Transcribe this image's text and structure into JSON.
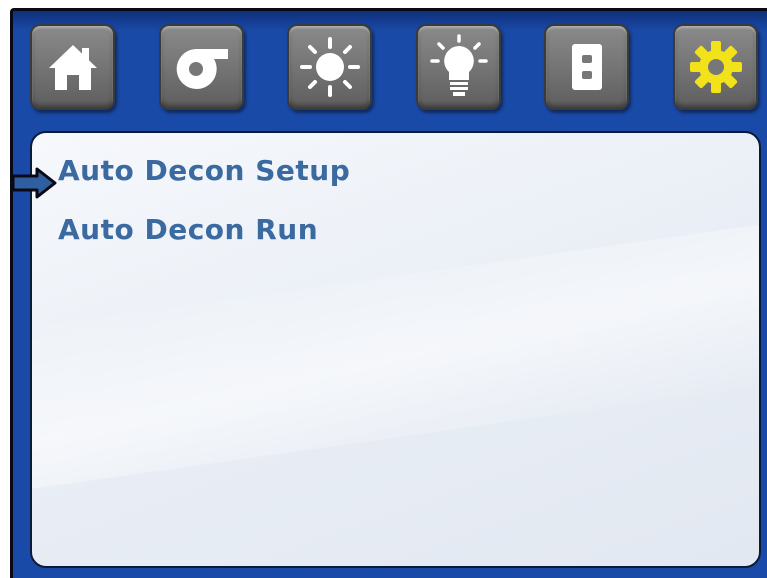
{
  "toolbar": {
    "buttons": [
      {
        "name": "home",
        "icon": "home-icon"
      },
      {
        "name": "fan",
        "icon": "blower-fan-icon"
      },
      {
        "name": "uv-lamp",
        "icon": "sun-icon"
      },
      {
        "name": "light",
        "icon": "light-bulb-icon"
      },
      {
        "name": "outlet",
        "icon": "outlet-icon"
      },
      {
        "name": "settings",
        "icon": "gear-icon",
        "active_color": "#f2e21a"
      }
    ]
  },
  "menu": {
    "items": [
      {
        "label": "Auto Decon Setup",
        "selected": true
      },
      {
        "label": "Auto Decon Run",
        "selected": false
      }
    ]
  },
  "colors": {
    "frame": "#1a4aa8",
    "menu_text": "#3a6aa0",
    "icon_white": "#ffffff",
    "gear_yellow": "#f2e21a",
    "selection_arrow": "#2f5fa0"
  }
}
